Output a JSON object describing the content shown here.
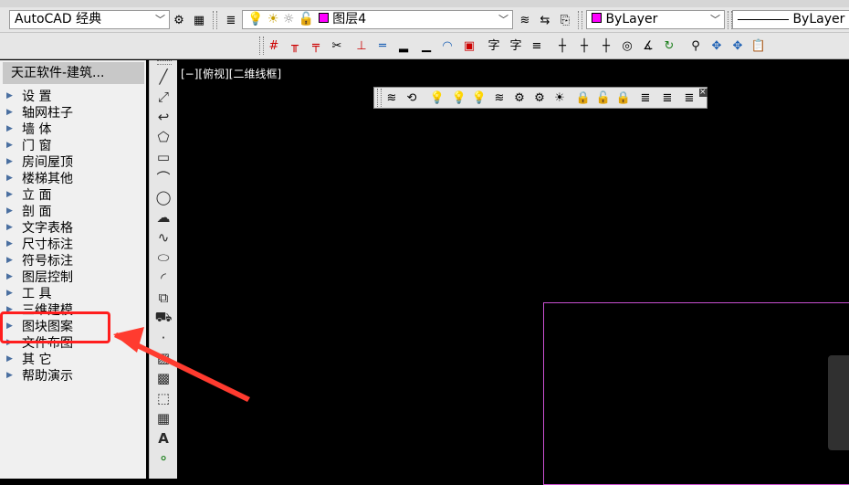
{
  "workspace": {
    "name": "AutoCAD 经典"
  },
  "layers": {
    "current": "图层4"
  },
  "properties": {
    "color": "ByLayer",
    "linetype": "ByLayer"
  },
  "palette": {
    "title": "天正软件-建筑...",
    "items": [
      "设 置",
      "轴网柱子",
      "墙 体",
      "门 窗",
      "房间屋顶",
      "楼梯其他",
      "立 面",
      "剖 面",
      "文字表格",
      "尺寸标注",
      "符号标注",
      "图层控制",
      "工 具",
      "三维建模",
      "图块图案",
      "文件布图",
      "其 它",
      "帮助演示"
    ],
    "highlighted": "图块图案"
  },
  "viewport": {
    "label": "[−][俯视][二维线框]"
  },
  "annotation": {
    "box_color": "#ff1e1e",
    "arrow_color": "#ff3b2f"
  },
  "colors": {
    "layer_swatch": "#ff00ff",
    "rect_outline": "#c84fd0"
  }
}
